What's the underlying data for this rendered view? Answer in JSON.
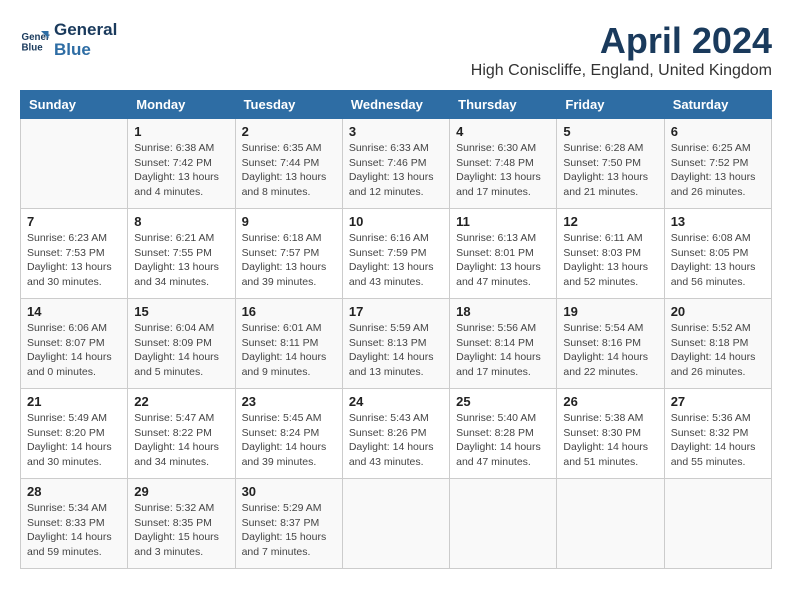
{
  "header": {
    "logo_line1": "General",
    "logo_line2": "Blue",
    "month": "April 2024",
    "location": "High Coniscliffe, England, United Kingdom"
  },
  "columns": [
    "Sunday",
    "Monday",
    "Tuesday",
    "Wednesday",
    "Thursday",
    "Friday",
    "Saturday"
  ],
  "weeks": [
    [
      {
        "day": "",
        "info": ""
      },
      {
        "day": "1",
        "info": "Sunrise: 6:38 AM\nSunset: 7:42 PM\nDaylight: 13 hours\nand 4 minutes."
      },
      {
        "day": "2",
        "info": "Sunrise: 6:35 AM\nSunset: 7:44 PM\nDaylight: 13 hours\nand 8 minutes."
      },
      {
        "day": "3",
        "info": "Sunrise: 6:33 AM\nSunset: 7:46 PM\nDaylight: 13 hours\nand 12 minutes."
      },
      {
        "day": "4",
        "info": "Sunrise: 6:30 AM\nSunset: 7:48 PM\nDaylight: 13 hours\nand 17 minutes."
      },
      {
        "day": "5",
        "info": "Sunrise: 6:28 AM\nSunset: 7:50 PM\nDaylight: 13 hours\nand 21 minutes."
      },
      {
        "day": "6",
        "info": "Sunrise: 6:25 AM\nSunset: 7:52 PM\nDaylight: 13 hours\nand 26 minutes."
      }
    ],
    [
      {
        "day": "7",
        "info": "Sunrise: 6:23 AM\nSunset: 7:53 PM\nDaylight: 13 hours\nand 30 minutes."
      },
      {
        "day": "8",
        "info": "Sunrise: 6:21 AM\nSunset: 7:55 PM\nDaylight: 13 hours\nand 34 minutes."
      },
      {
        "day": "9",
        "info": "Sunrise: 6:18 AM\nSunset: 7:57 PM\nDaylight: 13 hours\nand 39 minutes."
      },
      {
        "day": "10",
        "info": "Sunrise: 6:16 AM\nSunset: 7:59 PM\nDaylight: 13 hours\nand 43 minutes."
      },
      {
        "day": "11",
        "info": "Sunrise: 6:13 AM\nSunset: 8:01 PM\nDaylight: 13 hours\nand 47 minutes."
      },
      {
        "day": "12",
        "info": "Sunrise: 6:11 AM\nSunset: 8:03 PM\nDaylight: 13 hours\nand 52 minutes."
      },
      {
        "day": "13",
        "info": "Sunrise: 6:08 AM\nSunset: 8:05 PM\nDaylight: 13 hours\nand 56 minutes."
      }
    ],
    [
      {
        "day": "14",
        "info": "Sunrise: 6:06 AM\nSunset: 8:07 PM\nDaylight: 14 hours\nand 0 minutes."
      },
      {
        "day": "15",
        "info": "Sunrise: 6:04 AM\nSunset: 8:09 PM\nDaylight: 14 hours\nand 5 minutes."
      },
      {
        "day": "16",
        "info": "Sunrise: 6:01 AM\nSunset: 8:11 PM\nDaylight: 14 hours\nand 9 minutes."
      },
      {
        "day": "17",
        "info": "Sunrise: 5:59 AM\nSunset: 8:13 PM\nDaylight: 14 hours\nand 13 minutes."
      },
      {
        "day": "18",
        "info": "Sunrise: 5:56 AM\nSunset: 8:14 PM\nDaylight: 14 hours\nand 17 minutes."
      },
      {
        "day": "19",
        "info": "Sunrise: 5:54 AM\nSunset: 8:16 PM\nDaylight: 14 hours\nand 22 minutes."
      },
      {
        "day": "20",
        "info": "Sunrise: 5:52 AM\nSunset: 8:18 PM\nDaylight: 14 hours\nand 26 minutes."
      }
    ],
    [
      {
        "day": "21",
        "info": "Sunrise: 5:49 AM\nSunset: 8:20 PM\nDaylight: 14 hours\nand 30 minutes."
      },
      {
        "day": "22",
        "info": "Sunrise: 5:47 AM\nSunset: 8:22 PM\nDaylight: 14 hours\nand 34 minutes."
      },
      {
        "day": "23",
        "info": "Sunrise: 5:45 AM\nSunset: 8:24 PM\nDaylight: 14 hours\nand 39 minutes."
      },
      {
        "day": "24",
        "info": "Sunrise: 5:43 AM\nSunset: 8:26 PM\nDaylight: 14 hours\nand 43 minutes."
      },
      {
        "day": "25",
        "info": "Sunrise: 5:40 AM\nSunset: 8:28 PM\nDaylight: 14 hours\nand 47 minutes."
      },
      {
        "day": "26",
        "info": "Sunrise: 5:38 AM\nSunset: 8:30 PM\nDaylight: 14 hours\nand 51 minutes."
      },
      {
        "day": "27",
        "info": "Sunrise: 5:36 AM\nSunset: 8:32 PM\nDaylight: 14 hours\nand 55 minutes."
      }
    ],
    [
      {
        "day": "28",
        "info": "Sunrise: 5:34 AM\nSunset: 8:33 PM\nDaylight: 14 hours\nand 59 minutes."
      },
      {
        "day": "29",
        "info": "Sunrise: 5:32 AM\nSunset: 8:35 PM\nDaylight: 15 hours\nand 3 minutes."
      },
      {
        "day": "30",
        "info": "Sunrise: 5:29 AM\nSunset: 8:37 PM\nDaylight: 15 hours\nand 7 minutes."
      },
      {
        "day": "",
        "info": ""
      },
      {
        "day": "",
        "info": ""
      },
      {
        "day": "",
        "info": ""
      },
      {
        "day": "",
        "info": ""
      }
    ]
  ]
}
